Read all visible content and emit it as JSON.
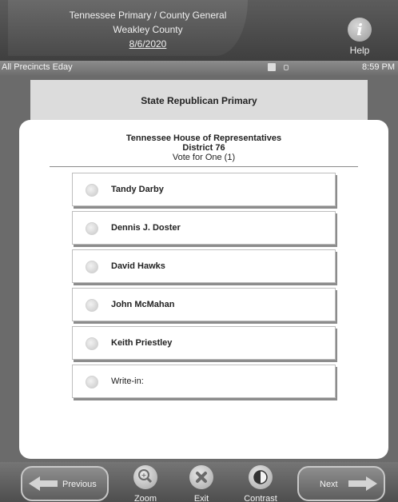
{
  "header": {
    "election_name": "Tennessee Primary / County General",
    "county": "Weakley County",
    "date": "8/6/2020",
    "help_icon_glyph": "i",
    "help_label": "Help"
  },
  "status_bar": {
    "precinct": "All Precincts Eday",
    "time": "8:59 PM",
    "icons": [
      "memo-icon",
      "battery-icon"
    ]
  },
  "contest": {
    "ballot_title": "State Republican Primary",
    "office": "Tennessee House of Representatives",
    "district": "District 76",
    "vote_for": "Vote for One (1)"
  },
  "candidates": [
    {
      "name": "Tandy Darby"
    },
    {
      "name": "Dennis J. Doster"
    },
    {
      "name": "David Hawks"
    },
    {
      "name": "John McMahan"
    },
    {
      "name": "Keith Priestley"
    },
    {
      "name": "Write-in:"
    }
  ],
  "toolbar": {
    "previous_label": "Previous",
    "next_label": "Next",
    "zoom_label": "Zoom",
    "exit_label": "Exit",
    "contrast_label": "Contrast"
  },
  "colors": {
    "header_bg": "#4a4a4a",
    "ballot_bg": "#ffffff",
    "band_bg": "#dcdcdc"
  }
}
